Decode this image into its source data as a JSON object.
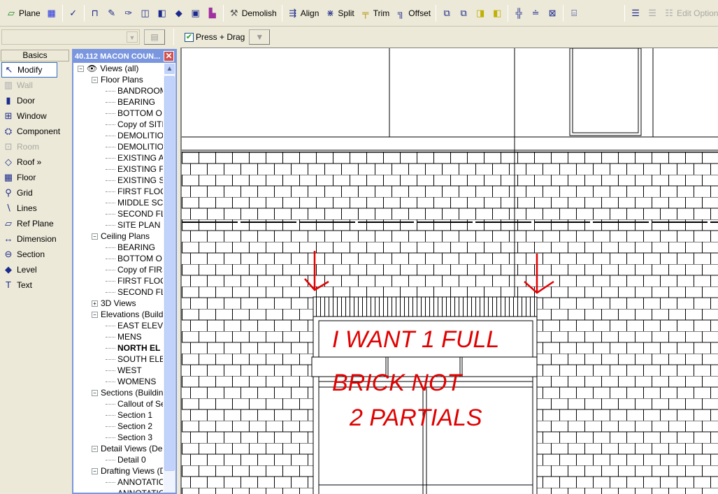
{
  "toolbar": {
    "plane": "Plane",
    "demolish": "Demolish",
    "align": "Align",
    "split": "Split",
    "trim": "Trim",
    "offset": "Offset",
    "edit_option": "Edit Option"
  },
  "options_bar": {
    "type_combo": "",
    "press_drag": "Press + Drag",
    "press_drag_checked": true
  },
  "design_bar": {
    "tab": "Basics",
    "items": [
      {
        "label": "Modify",
        "icon": "arrow-icon",
        "selected": true,
        "enabled": true
      },
      {
        "label": "Wall",
        "icon": "wall-icon",
        "enabled": false
      },
      {
        "label": "Door",
        "icon": "door-icon",
        "enabled": true
      },
      {
        "label": "Window",
        "icon": "window-icon",
        "enabled": true
      },
      {
        "label": "Component",
        "icon": "component-icon",
        "enabled": true
      },
      {
        "label": "Room",
        "icon": "room-icon",
        "enabled": false
      },
      {
        "label": "Roof »",
        "icon": "roof-icon",
        "enabled": true
      },
      {
        "label": "Floor",
        "icon": "floor-icon",
        "enabled": true
      },
      {
        "label": "Grid",
        "icon": "grid-icon",
        "enabled": true
      },
      {
        "label": "Lines",
        "icon": "lines-icon",
        "enabled": true
      },
      {
        "label": "Ref Plane",
        "icon": "ref-plane-icon",
        "enabled": true
      },
      {
        "label": "Dimension",
        "icon": "dimension-icon",
        "enabled": true
      },
      {
        "label": "Section",
        "icon": "section-icon",
        "enabled": true
      },
      {
        "label": "Level",
        "icon": "level-icon",
        "enabled": true
      },
      {
        "label": "Text",
        "icon": "text-icon",
        "enabled": true
      }
    ]
  },
  "project_browser": {
    "title": "40.112 MACON COUN...",
    "nodes": [
      {
        "label": "Views (all)",
        "level": 0,
        "expander": "-",
        "eye": true
      },
      {
        "label": "Floor Plans",
        "level": 1,
        "expander": "-"
      },
      {
        "label": "BANDROOM",
        "level": 2
      },
      {
        "label": "BEARING",
        "level": 2
      },
      {
        "label": "BOTTOM O",
        "level": 2
      },
      {
        "label": "Copy of SITI",
        "level": 2
      },
      {
        "label": "DEMOLITIO",
        "level": 2
      },
      {
        "label": "DEMOLITIO",
        "level": 2
      },
      {
        "label": "EXISTING A",
        "level": 2
      },
      {
        "label": "EXISTING F",
        "level": 2
      },
      {
        "label": "EXISTING S",
        "level": 2
      },
      {
        "label": "FIRST FLOO",
        "level": 2
      },
      {
        "label": "MIDDLE SC",
        "level": 2
      },
      {
        "label": "SECOND FL",
        "level": 2
      },
      {
        "label": "SITE PLAN",
        "level": 2
      },
      {
        "label": "Ceiling Plans",
        "level": 1,
        "expander": "-"
      },
      {
        "label": "BEARING",
        "level": 2
      },
      {
        "label": "BOTTOM O",
        "level": 2
      },
      {
        "label": "Copy of FIRS",
        "level": 2
      },
      {
        "label": "FIRST FLOO",
        "level": 2
      },
      {
        "label": "SECOND FL",
        "level": 2
      },
      {
        "label": "3D Views",
        "level": 1,
        "expander": "+"
      },
      {
        "label": "Elevations (Build",
        "level": 1,
        "expander": "-"
      },
      {
        "label": "EAST ELEV",
        "level": 2
      },
      {
        "label": "MENS",
        "level": 2
      },
      {
        "label": "NORTH EL",
        "level": 2,
        "bold": true
      },
      {
        "label": "SOUTH ELE",
        "level": 2
      },
      {
        "label": "WEST",
        "level": 2
      },
      {
        "label": "WOMENS",
        "level": 2
      },
      {
        "label": "Sections (Buildin",
        "level": 1,
        "expander": "-"
      },
      {
        "label": "Callout of Se",
        "level": 2
      },
      {
        "label": "Section 1",
        "level": 2
      },
      {
        "label": "Section 2",
        "level": 2
      },
      {
        "label": "Section 3",
        "level": 2
      },
      {
        "label": "Detail Views (De",
        "level": 1,
        "expander": "-"
      },
      {
        "label": "Detail 0",
        "level": 2
      },
      {
        "label": "Drafting Views (D",
        "level": 1,
        "expander": "-"
      },
      {
        "label": "ANNOTATIO",
        "level": 2
      },
      {
        "label": "ANNOTATIO",
        "level": 2
      }
    ]
  },
  "annotation": {
    "color": "#e00000",
    "line1": "I WANT 1 FULL",
    "line2": "BRICK NOT",
    "line3": "2 PARTIALS"
  }
}
